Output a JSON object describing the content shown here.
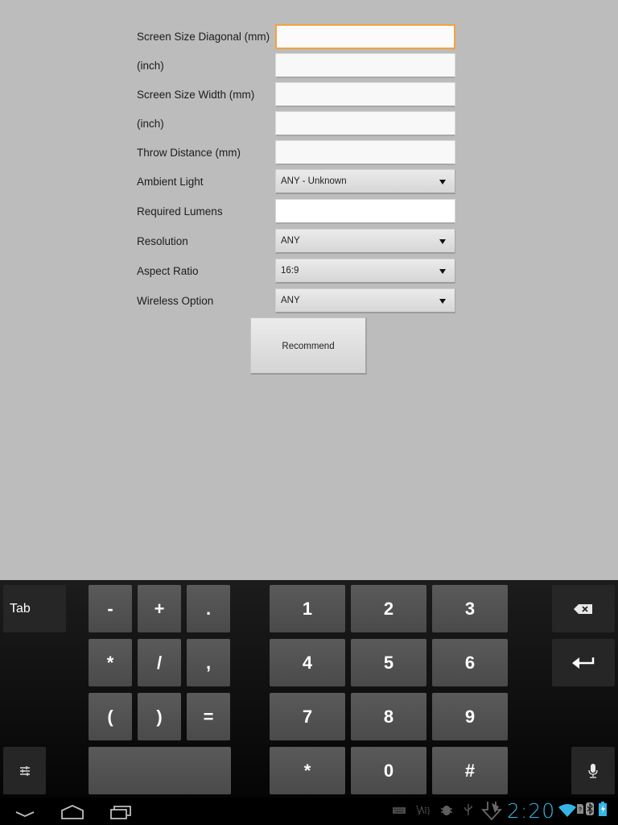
{
  "form": {
    "fields": [
      {
        "label": "Screen Size Diagonal (mm)",
        "value": "",
        "type": "text",
        "focused": true
      },
      {
        "label": "(inch)",
        "value": "",
        "type": "text"
      },
      {
        "label": "Screen Size Width (mm)",
        "value": "",
        "type": "text"
      },
      {
        "label": "(inch)",
        "value": "",
        "type": "text"
      },
      {
        "label": "Throw Distance (mm)",
        "value": "",
        "type": "text"
      },
      {
        "label": "Ambient Light",
        "value": "ANY - Unknown",
        "type": "spinner"
      },
      {
        "label": "Required Lumens",
        "value": "",
        "type": "text"
      },
      {
        "label": "Resolution",
        "value": "ANY",
        "type": "spinner"
      },
      {
        "label": "Aspect Ratio",
        "value": "16:9",
        "type": "spinner"
      },
      {
        "label": "Wireless Option",
        "value": "ANY",
        "type": "spinner"
      }
    ],
    "recommend_label": "Recommend",
    "focus_color": "#f4a23a"
  },
  "keyboard": {
    "tab_label": "Tab",
    "symbols": [
      "-",
      "+",
      ".",
      "*",
      "/",
      ",",
      "(",
      ")",
      "="
    ],
    "digits": [
      "1",
      "2",
      "3",
      "4",
      "5",
      "6",
      "7",
      "8",
      "9",
      "*",
      "0",
      "#"
    ],
    "icons": {
      "backspace": "backspace-icon",
      "enter": "enter-icon",
      "settings": "settings-sliders-icon",
      "mic": "microphone-icon",
      "space": "space-bar"
    }
  },
  "system_bar": {
    "clock": "2:20",
    "clock_color": "#35b5e5",
    "nav": [
      "back-icon",
      "home-icon",
      "recent-apps-icon"
    ],
    "status_icons": [
      "keyboard-icon",
      "swype-icon",
      "android-debug-icon",
      "usb-icon",
      "download-icon",
      "wifi-icon",
      "no-sim-icon",
      "bluetooth-icon",
      "battery-charging-icon"
    ]
  }
}
